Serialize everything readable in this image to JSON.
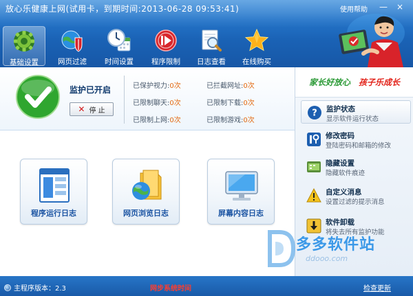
{
  "window": {
    "title": "放心乐健康上网(试用卡，到期时间:2013-06-28 09:53:41)",
    "help_link": "使用帮助",
    "minimize_glyph": "—",
    "close_glyph": "×"
  },
  "toolbar": {
    "items": [
      {
        "label": "基础设置",
        "icon": "gear-icon",
        "active": true
      },
      {
        "label": "网页过滤",
        "icon": "globe-shield-icon",
        "active": false
      },
      {
        "label": "时间设置",
        "icon": "clock-calendar-icon",
        "active": false
      },
      {
        "label": "程序限制",
        "icon": "play-button-icon",
        "active": false
      },
      {
        "label": "日志查看",
        "icon": "magnifier-log-icon",
        "active": false
      },
      {
        "label": "在线购买",
        "icon": "star-icon",
        "active": false
      }
    ]
  },
  "status": {
    "state_label": "监护已开启",
    "stop_label": "停 止",
    "stats": [
      {
        "label": "已保护视力:",
        "value": "0次"
      },
      {
        "label": "已拦截网址:",
        "value": "0次"
      },
      {
        "label": "已限制聊天:",
        "value": "0次"
      },
      {
        "label": "已限制下载:",
        "value": "0次"
      },
      {
        "label": "已限制上网:",
        "value": "0次"
      },
      {
        "label": "已限制游戏:",
        "value": "0次"
      }
    ]
  },
  "logs": [
    {
      "label": "程序运行日志",
      "icon": "program-log-icon"
    },
    {
      "label": "网页浏览日志",
      "icon": "web-log-icon"
    },
    {
      "label": "屏幕内容日志",
      "icon": "screen-log-icon"
    }
  ],
  "sidebar": {
    "slogan_left": "家长好放心",
    "slogan_right": "孩子乐成长",
    "items": [
      {
        "title": "监护状态",
        "desc": "显示软件运行状态",
        "icon": "question-icon",
        "active": true
      },
      {
        "title": "修改密码",
        "desc": "登陆密码和邮箱的修改",
        "icon": "password-icon",
        "active": false
      },
      {
        "title": "隐藏设置",
        "desc": "隐藏软件痕迹",
        "icon": "hide-icon",
        "active": false
      },
      {
        "title": "自定义消息",
        "desc": "设置过滤的提示消息",
        "icon": "warning-icon",
        "active": false
      },
      {
        "title": "软件卸载",
        "desc": "将失去所有监护功能",
        "icon": "uninstall-icon",
        "active": false
      }
    ]
  },
  "watermark": {
    "name": "多多软件站",
    "url": "ddooo.com"
  },
  "footer": {
    "version": "主程序版本：2.3",
    "brand": "网步系统时间",
    "check_update": "检查更新"
  },
  "colors": {
    "header_blue": "#1a62b5",
    "accent_orange": "#e36a12",
    "slogan_green": "#2b9a36",
    "slogan_red": "#e2231a"
  }
}
